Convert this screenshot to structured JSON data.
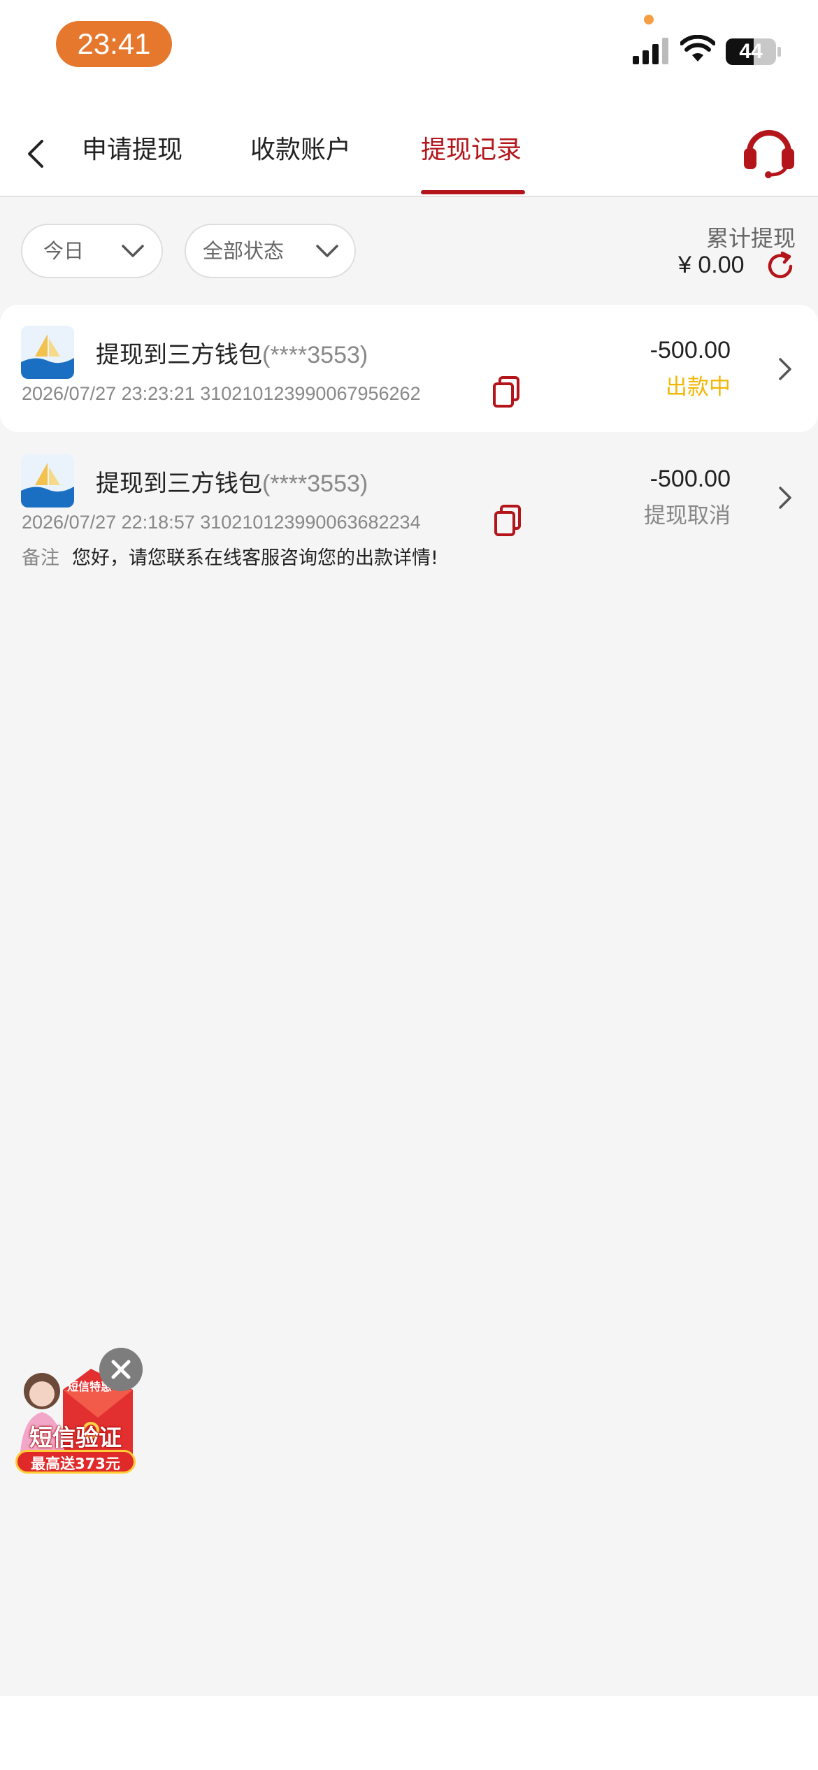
{
  "status_bar": {
    "time": "23:41",
    "battery": "44"
  },
  "nav": {
    "tabs": [
      {
        "label": "申请提现"
      },
      {
        "label": "收款账户"
      },
      {
        "label": "提现记录"
      }
    ],
    "active_tab": "提现记录"
  },
  "filters": {
    "date": "今日",
    "status": "全部状态"
  },
  "summary": {
    "label": "累计提现",
    "amount": "¥ 0.00"
  },
  "records": [
    {
      "title": "提现到三方钱包",
      "account": "(****3553)",
      "datetime": "2026/07/27 23:23:21",
      "order_id": "310210123990067956262",
      "amount": "-500.00",
      "status": "出款中",
      "status_color": "#f2b705"
    },
    {
      "title": "提现到三方钱包",
      "account": "(****3553)",
      "datetime": "2026/07/27 22:18:57",
      "order_id": "310210123990063682234",
      "amount": "-500.00",
      "status": "提现取消",
      "status_color": "#888888",
      "remark_label": "备注",
      "remark": "您好，请您联系在线客服咨询您的出款详情!"
    }
  ],
  "promo": {
    "badge": "短信特惠",
    "title": "短信验证",
    "subtitle": "最高送373元"
  },
  "colors": {
    "accent": "#b3151a",
    "pending": "#f2b705",
    "cancelled": "#888888"
  }
}
